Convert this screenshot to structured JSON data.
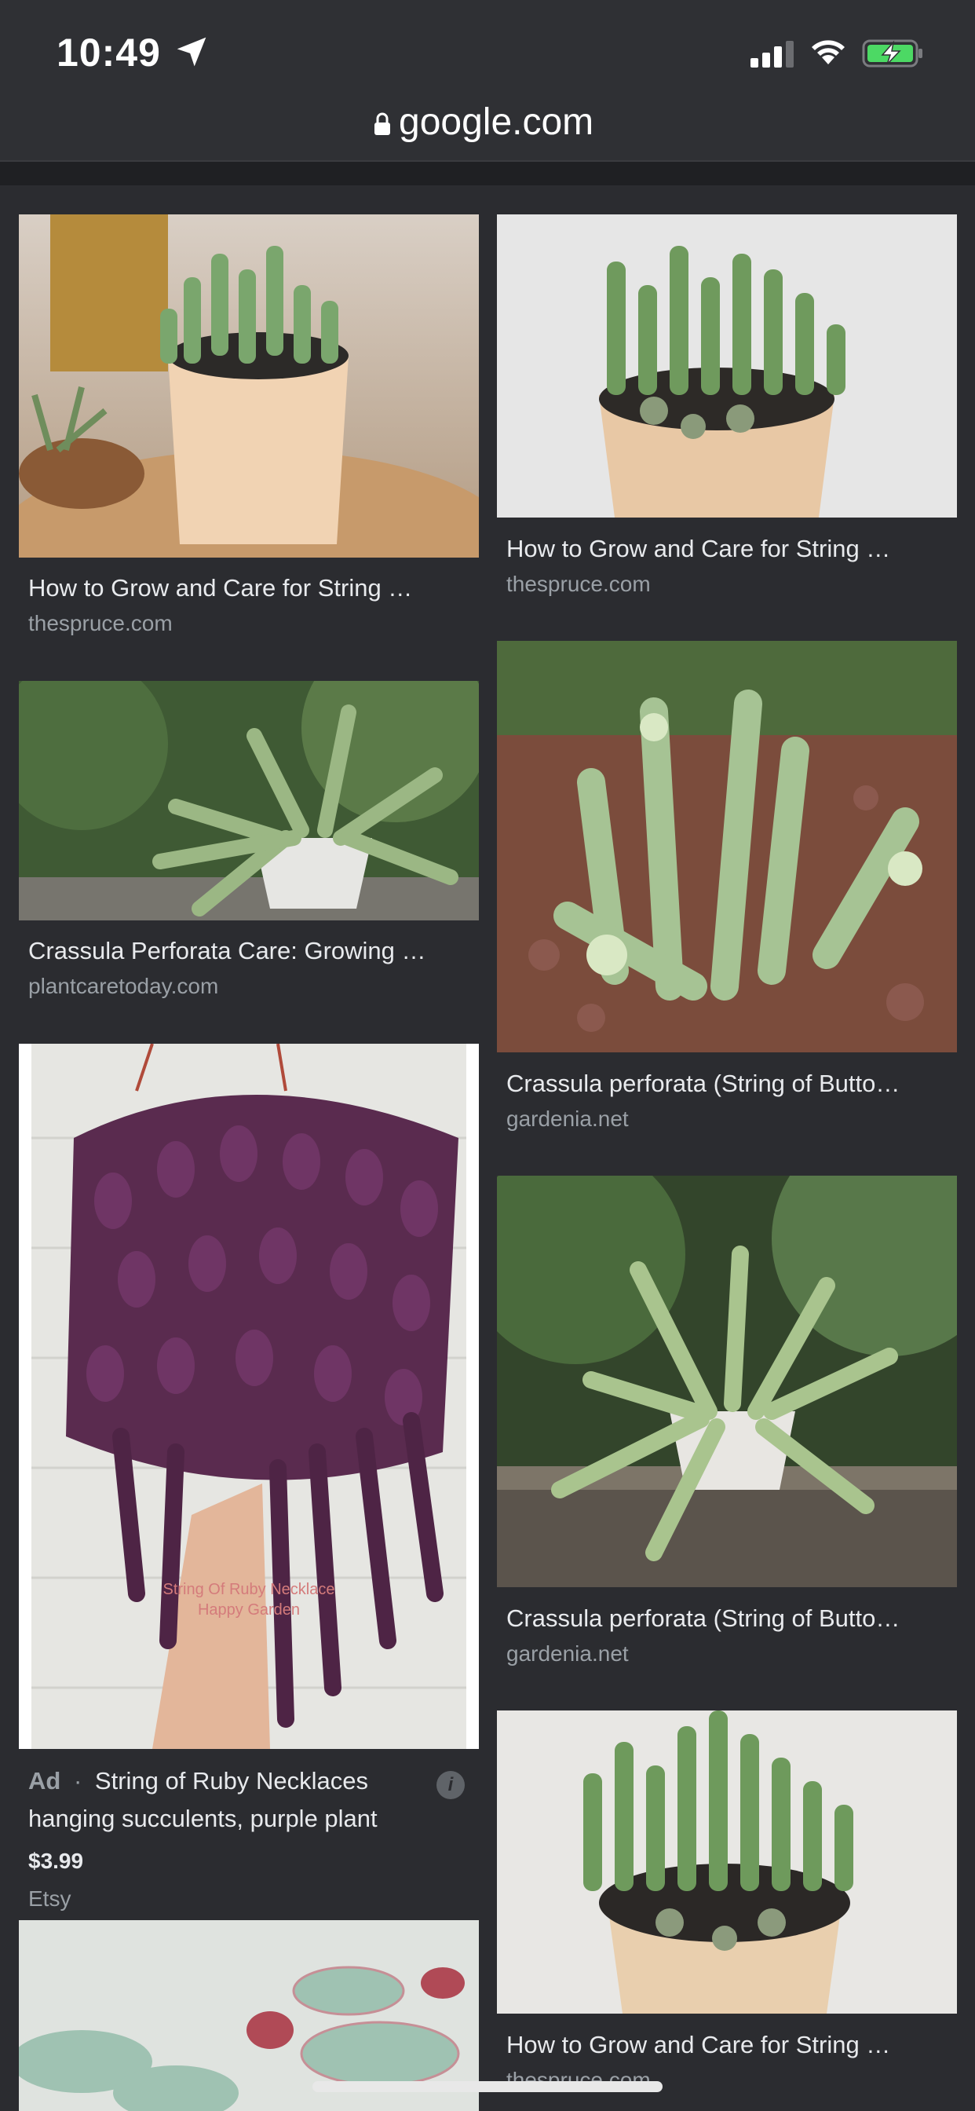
{
  "status_bar": {
    "time": "10:49",
    "icons": [
      "location-arrow-icon",
      "cellular-signal-icon",
      "wifi-icon",
      "battery-charging-icon"
    ]
  },
  "address_bar": {
    "url": "google.com",
    "icon": "lock-icon"
  },
  "results": [
    {
      "title": "How to Grow and Care for String …",
      "source": "thespruce.com"
    },
    {
      "title": "How to Grow and Care for String …",
      "source": "thespruce.com"
    },
    {
      "title": "Crassula Perforata Care: Growing …",
      "source": "plantcaretoday.com"
    },
    {
      "title": "Crassula perforata (String of Butto…",
      "source": "gardenia.net"
    },
    {
      "title": "Crassula perforata (String of Butto…",
      "source": "gardenia.net"
    },
    {
      "title": "How to Grow and Care for String …",
      "source": "thespruce.com"
    }
  ],
  "ad": {
    "badge": "Ad",
    "dot": "·",
    "title_line1": "String of Ruby Necklaces",
    "title_line2": "hanging succulents, purple plant",
    "price": "$3.99",
    "seller": "Etsy",
    "watermark_line1": "String Of Ruby Necklace",
    "watermark_line2": "Happy Garden",
    "info_icon": "i"
  }
}
